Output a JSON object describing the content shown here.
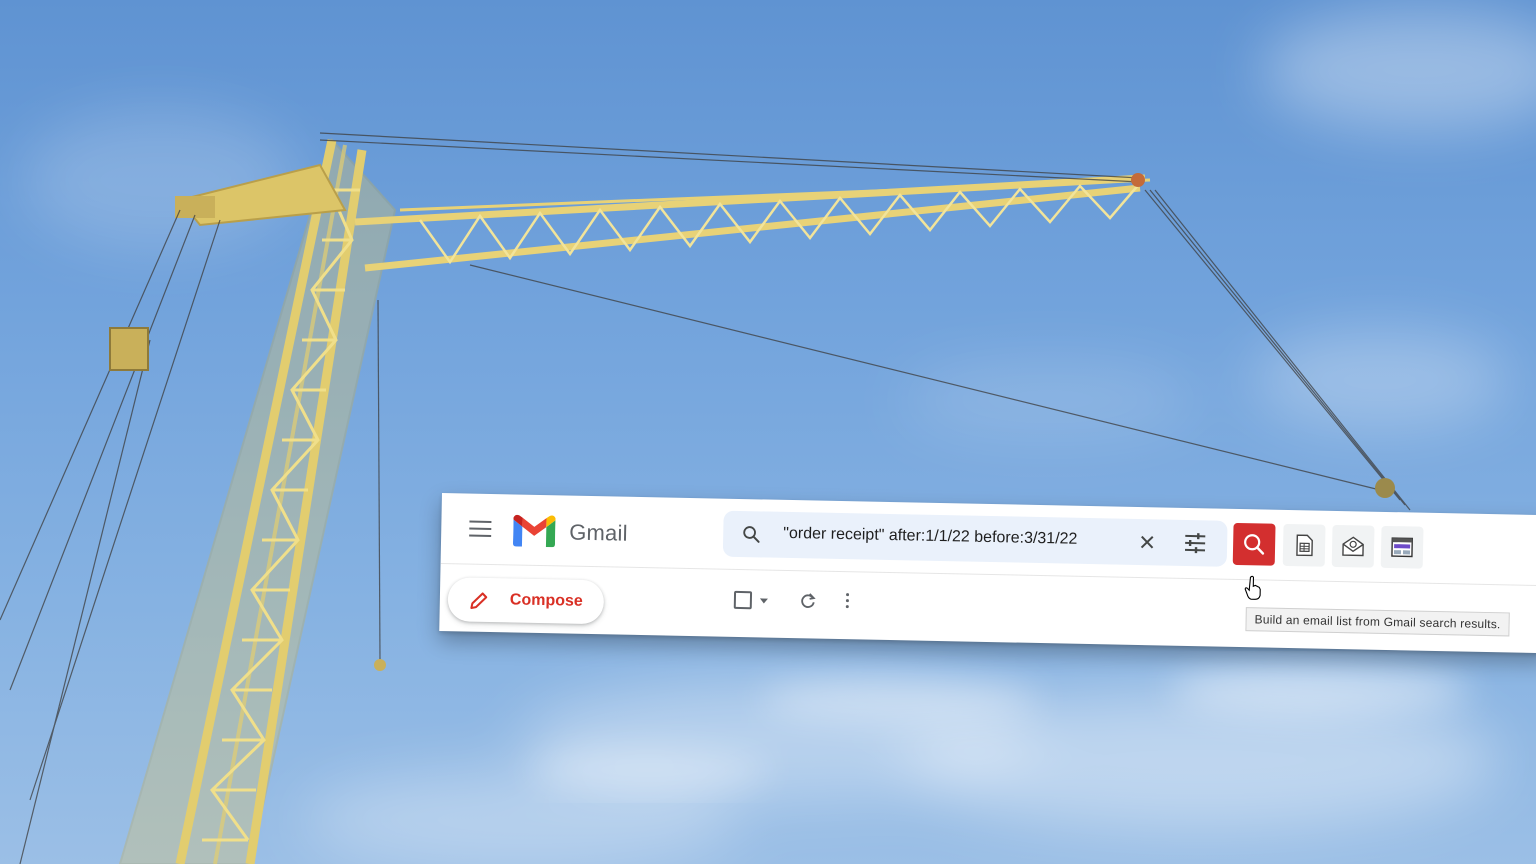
{
  "background": {
    "description_colors": {
      "sky_top": "#5f93d2",
      "sky_bottom": "#9bbfe6",
      "crane": "#e8d277"
    }
  },
  "gmail": {
    "menu_icon": "hamburger-menu-icon",
    "logo_text": "Gmail",
    "search": {
      "icon": "search-icon",
      "query": "\"order receipt\" after:1/1/22 before:3/31/22",
      "clear_icon": "close-icon",
      "options_icon": "tune-icon"
    },
    "extension_buttons": [
      {
        "icon": "search-icon",
        "color": "#d32f2f"
      },
      {
        "icon": "spreadsheet-icon"
      },
      {
        "icon": "email-envelope-icon"
      },
      {
        "icon": "webpage-icon"
      }
    ],
    "compose_label": "Compose",
    "toolbar": {
      "select_icon": "checkbox-icon",
      "refresh_icon": "refresh-icon",
      "more_icon": "more-vert-icon"
    },
    "tooltip": "Build an email list from Gmail search results.",
    "accent": "#d93025"
  }
}
